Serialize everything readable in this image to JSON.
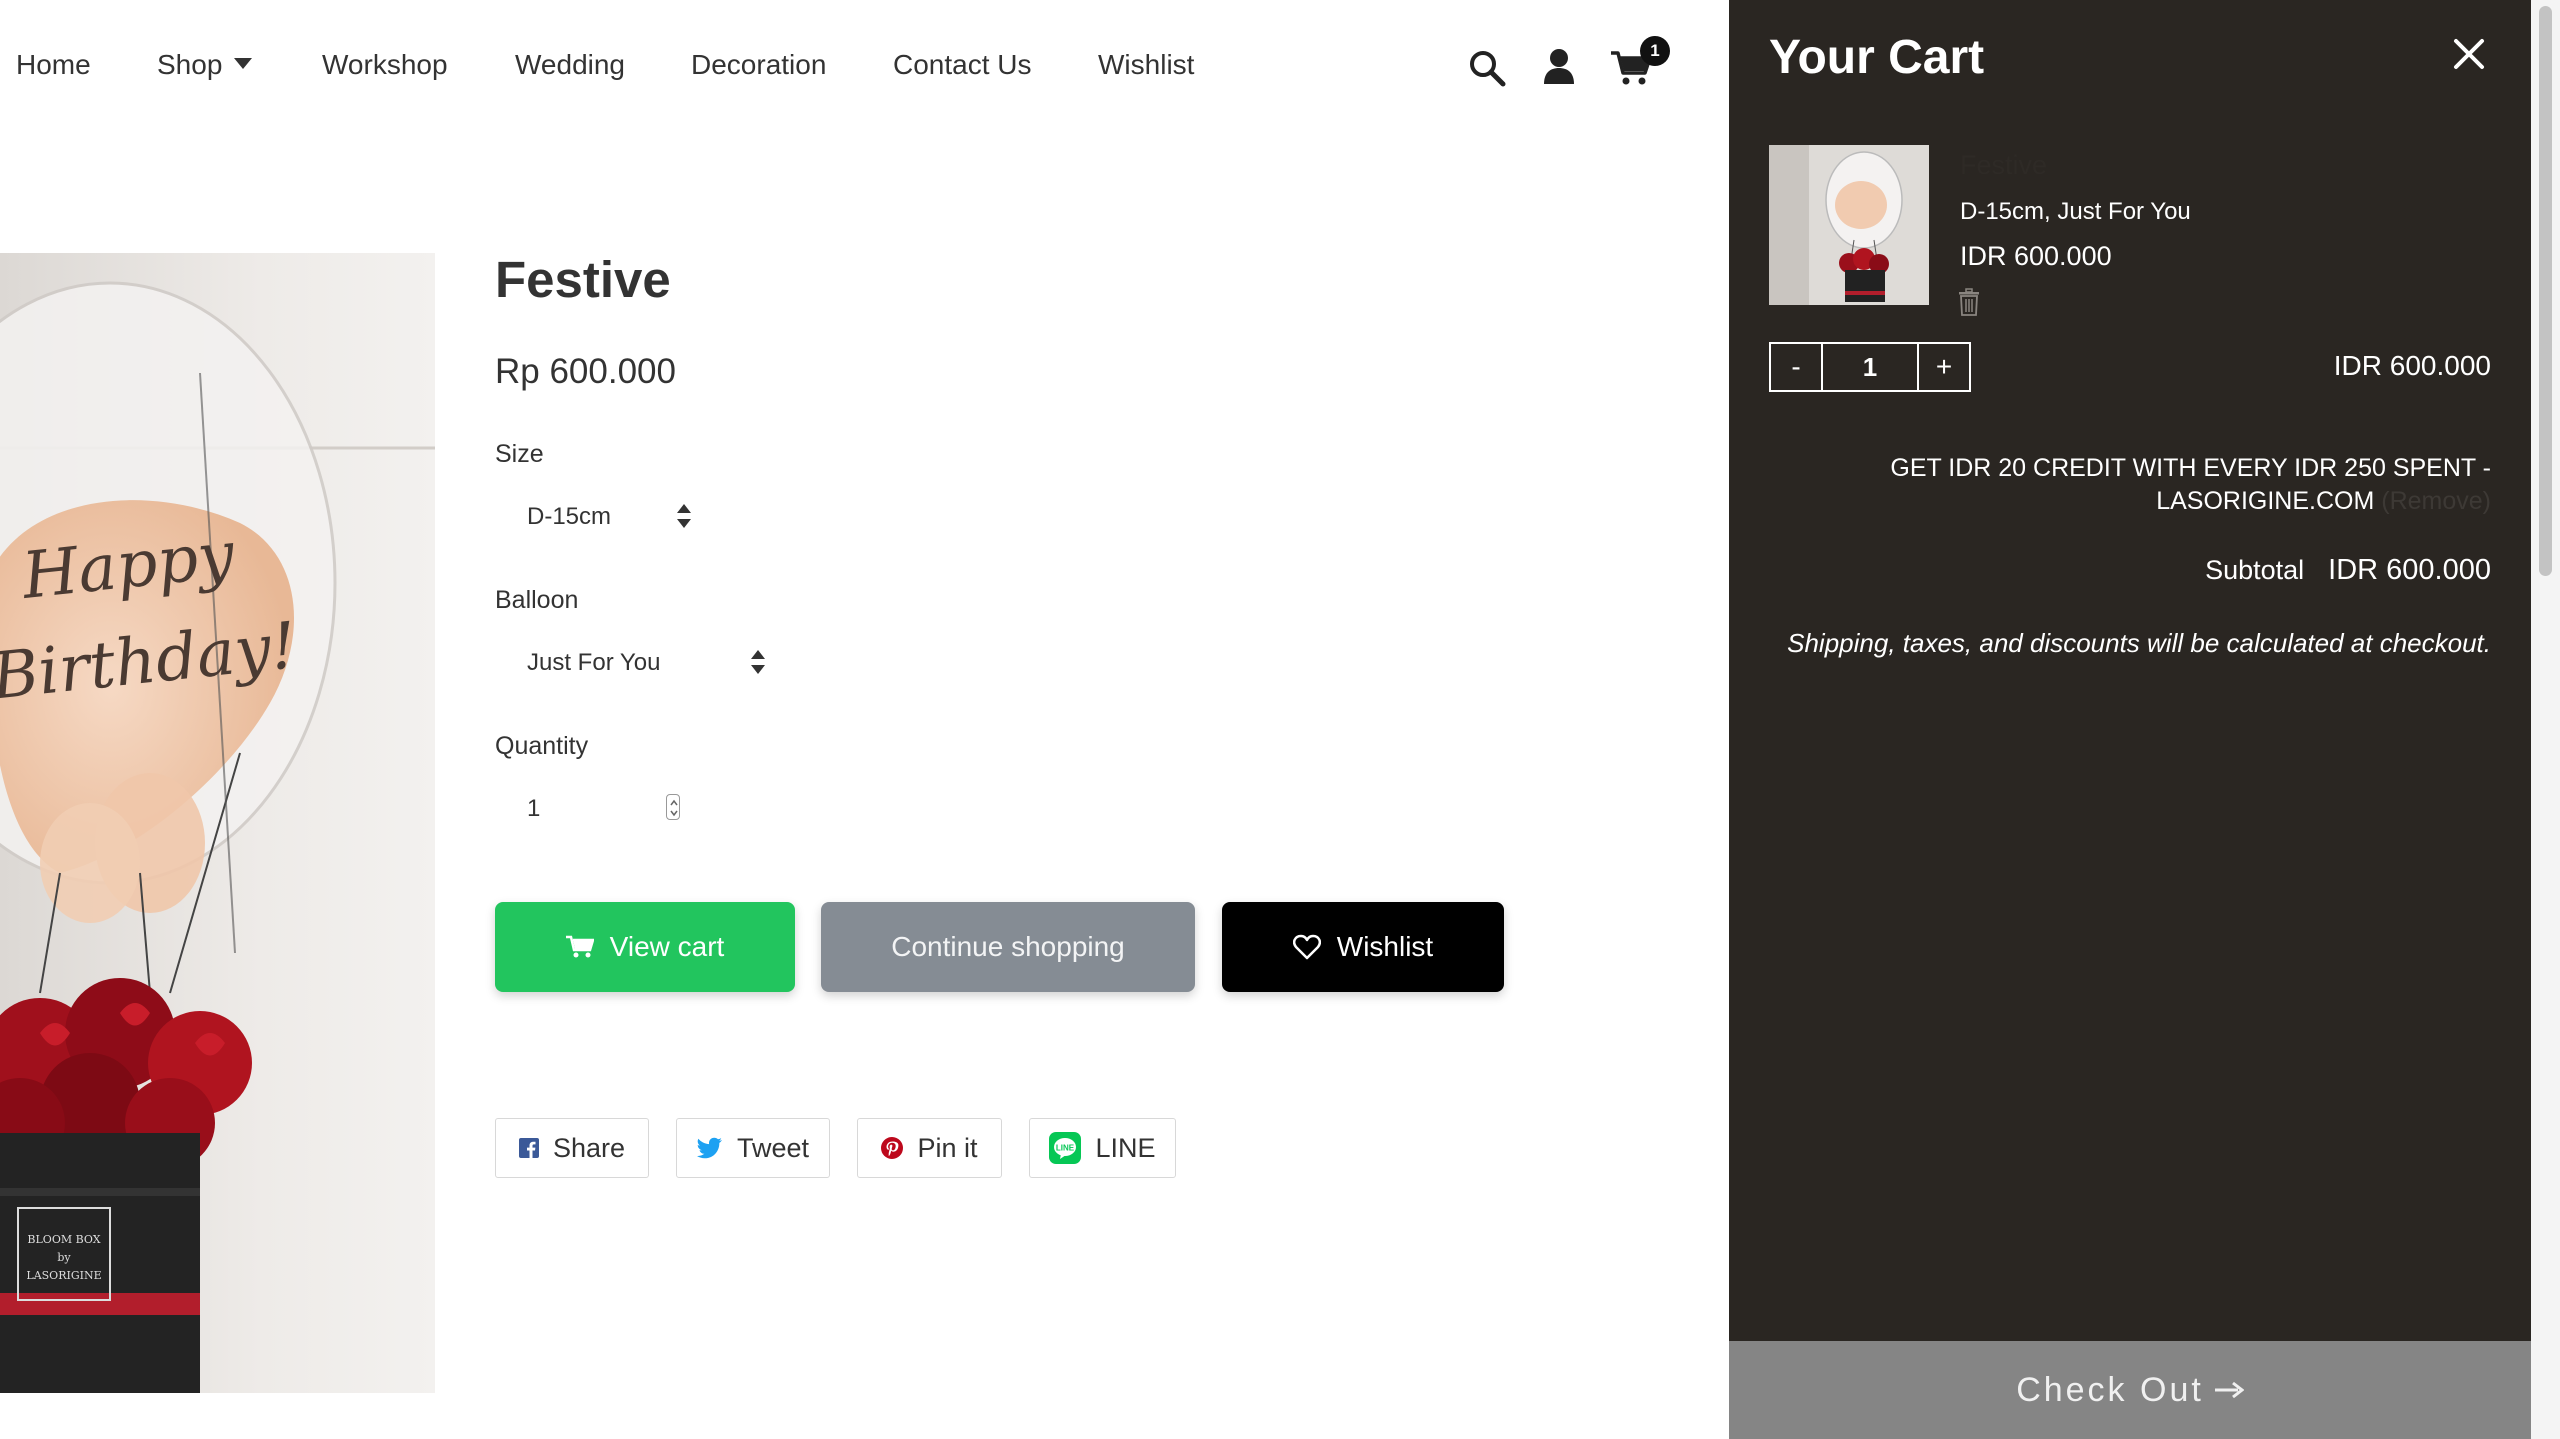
{
  "nav": {
    "items": [
      {
        "label": "Home"
      },
      {
        "label": "Shop"
      },
      {
        "label": "Workshop"
      },
      {
        "label": "Wedding"
      },
      {
        "label": "Decoration"
      },
      {
        "label": "Contact Us"
      },
      {
        "label": "Wishlist"
      }
    ],
    "cart_count": "1"
  },
  "product": {
    "title": "Festive",
    "price": "Rp 600.000",
    "size_label": "Size",
    "size_value": "D-15cm",
    "balloon_label": "Balloon",
    "balloon_value": "Just For You",
    "quantity_label": "Quantity",
    "quantity_value": "1",
    "image_balloon_text_1": "Happy",
    "image_balloon_text_2": "Birthday!",
    "image_box_text_1": "BLOOM BOX",
    "image_box_text_2": "by",
    "image_box_text_3": "LASORIGINE"
  },
  "actions": {
    "view_cart": "View cart",
    "continue_shopping": "Continue shopping",
    "wishlist": "Wishlist"
  },
  "share": {
    "facebook": "Share",
    "twitter": "Tweet",
    "pinterest": "Pin it",
    "line": "LINE"
  },
  "cart": {
    "title": "Your Cart",
    "item": {
      "title": "Festive",
      "variant": "D-15cm, Just For You",
      "price": "IDR 600.000",
      "quantity": "1",
      "line_total": "IDR 600.000",
      "minus": "-",
      "plus": "+"
    },
    "credit_line_1": "GET IDR 20 CREDIT WITH EVERY IDR 250 SPENT -",
    "credit_line_2": "LASORIGINE.COM",
    "credit_faint": "(Remove)",
    "subtotal_label": "Subtotal",
    "subtotal_value": "IDR 600.000",
    "shipping_note": "Shipping, taxes, and discounts will be calculated at checkout.",
    "checkout_label": "Check Out"
  },
  "colors": {
    "view_cart_bg": "#22c55e",
    "continue_bg": "#858c94",
    "wishlist_bg": "#000000",
    "drawer_bg": "#2a2622",
    "checkout_bg": "#858585",
    "facebook": "#3b5998",
    "twitter": "#1da1f2",
    "pinterest": "#bd081c",
    "line": "#06c755"
  },
  "icons": [
    "search-icon",
    "user-icon",
    "cart-icon",
    "close-icon",
    "trash-icon",
    "heart-icon",
    "facebook-icon",
    "twitter-icon",
    "pinterest-icon",
    "line-icon",
    "arrow-right-icon"
  ]
}
